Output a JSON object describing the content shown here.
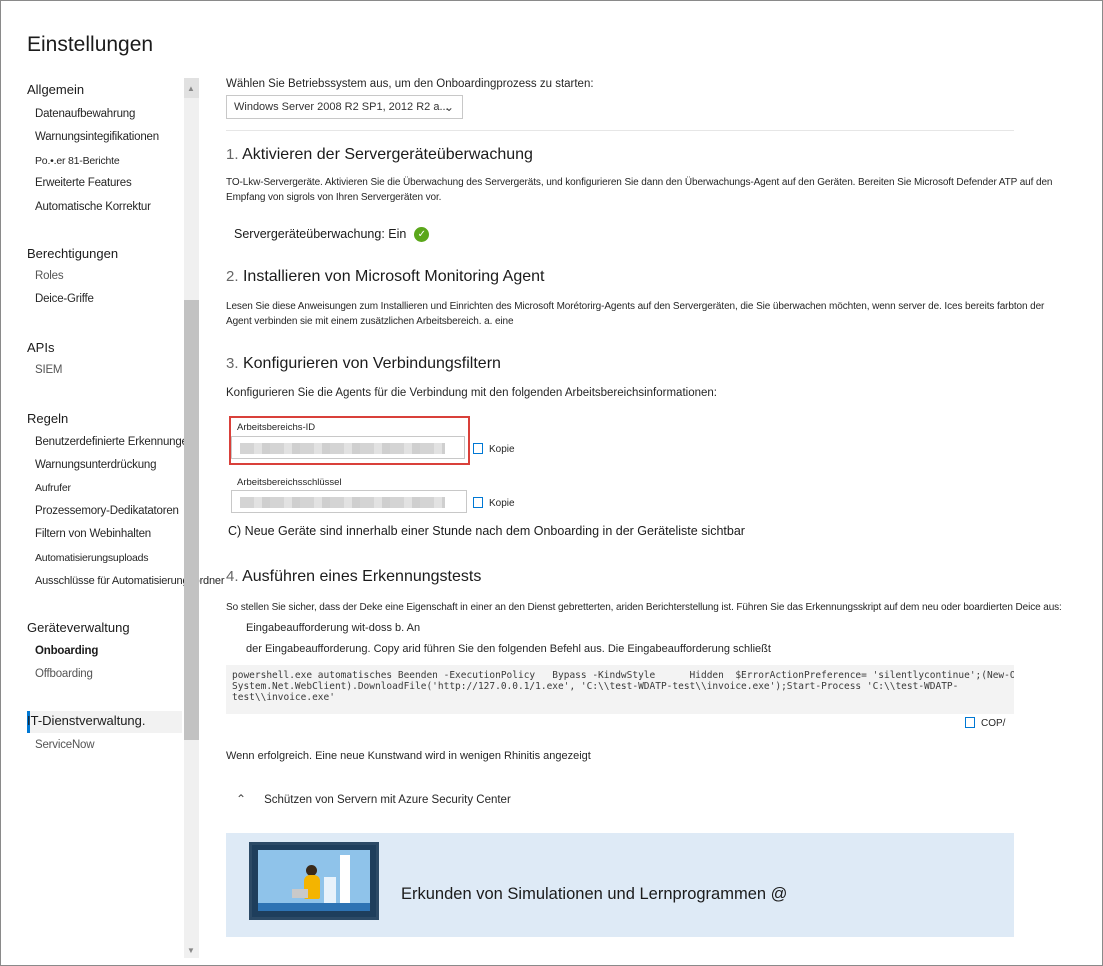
{
  "page": {
    "title": "Einstellungen"
  },
  "sidebar": {
    "sections": [
      {
        "heading": "Allgemein",
        "items": [
          "Datenaufbewahrung",
          "Warnungsintegifikationen",
          "Po.•.er 81-Berichte",
          "Erweiterte Features",
          "Automatische Korrektur"
        ]
      },
      {
        "heading": "Berechtigungen",
        "items": [
          "Roles",
          "Deice-Griffe"
        ]
      },
      {
        "heading": "APIs",
        "items": [
          "SIEM"
        ]
      },
      {
        "heading": "Regeln",
        "items": [
          "Benutzerdefinierte Erkennungen",
          "Warnungsunterdrückung",
          "Aufrufer",
          "Prozessemory-Dedikatatoren",
          "Filtern von Webinhalten",
          "Automatisierungsuploads",
          "Ausschlüsse für Automatisierungsordner"
        ]
      },
      {
        "heading": "Geräteverwaltung",
        "items": [
          "Onboarding",
          "Offboarding"
        ]
      },
      {
        "heading": "IT-Dienstverwaltung.",
        "items": [
          "ServiceNow"
        ]
      }
    ],
    "active_item": "Onboarding"
  },
  "os": {
    "label": "Wählen Sie Betriebssystem aus, um den Onboardingprozess zu starten:",
    "selected": "Windows Server 2008 R2 SP1, 2012 R2 a..."
  },
  "step1": {
    "num": "1.",
    "title": "Aktivieren der Servergeräteüberwachung",
    "desc": "TO-Lkw-Servergeräte. Aktivieren Sie die Überwachung des Servergeräts, und konfigurieren Sie dann den Überwachungs-Agent auf den Geräten. Bereiten Sie Microsoft Defender ATP auf den Empfang von sigrols von Ihren Servergeräten vor.",
    "status": "Servergeräteüberwachung: Ein",
    "status_color": "#5ba71b"
  },
  "step2": {
    "num": "2.",
    "title": "Installieren von Microsoft Monitoring Agent",
    "desc": "Lesen Sie diese Anweisungen zum Installieren und Einrichten des Microsoft Morétorirg-Agents auf den Servergeräten, die Sie überwachen möchten, wenn server de. Ices bereits farbton der Agent verbinden sie mit einem zusätzlichen Arbeitsbereich. a. eine"
  },
  "step3": {
    "num": "3.",
    "title": "Konfigurieren von Verbindungsfiltern",
    "desc": "Konfigurieren Sie die Agents für die Verbindung mit den folgenden Arbeitsbereichsinformationen:",
    "workspace_id_label": "Arbeitsbereichs-ID",
    "workspace_key_label": "Arbeitsbereichsschlüssel",
    "copy_label": "Kopie",
    "note": "C) Neue Geräte sind innerhalb einer Stunde nach dem Onboarding in der Geräteliste sichtbar",
    "highlight_color": "#d9403a"
  },
  "step4": {
    "num": "4.",
    "title": "Ausführen eines Erkennungstests",
    "desc": "So stellen Sie sicher, dass der Deke eine Eigenschaft in einer an den Dienst gebretterten, ariden Berichterstellung ist. Führen Sie das Erkennungsskript auf dem neu oder boardierten Deice aus:",
    "line1": "Eingabeaufforderung wit-doss b. An",
    "line2": "der Eingabeaufforderung. Copy arid führen Sie den folgenden Befehl aus. Die Eingabeaufforderung schließt",
    "code": "powershell.exe automatisches Beenden -ExecutionPolicy   Bypass -KindwStyle      Hidden  $ErrorActionPreference= 'silentlycontinue';(New-Object\nSystem.Net.WebClient).DownloadFile('http://127.0.0.1/1.exe', 'C:\\\\test-WDATP-test\\\\invoice.exe');Start-Process 'C:\\\\test-WDATP-\ntest\\\\invoice.exe'",
    "copy_label": "COP/",
    "success": "Wenn erfolgreich. Eine neue Kunstwand wird in wenigen Rhinitis angezeigt"
  },
  "collapse": {
    "label": "Schützen von Servern mit Azure Security Center"
  },
  "promo": {
    "text": "Erkunden von Simulationen und Lernprogrammen @",
    "bg": "#deeaf6"
  },
  "colors": {
    "accent": "#0078d4",
    "success": "#5ba71b",
    "highlight": "#d9403a"
  }
}
